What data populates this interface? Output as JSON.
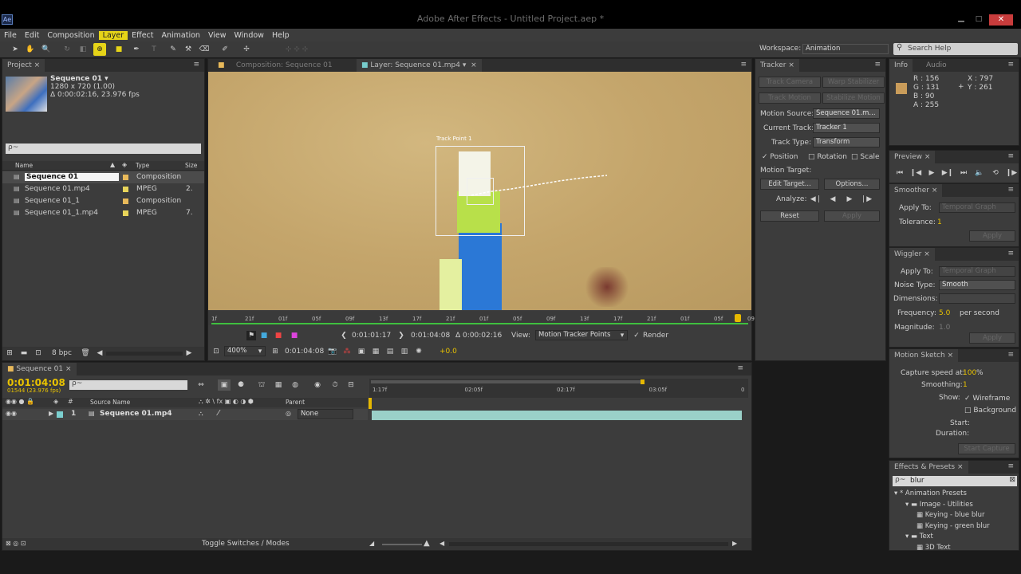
{
  "app": {
    "window_title": "Adobe After Effects - Untitled Project.aep *",
    "app_icon": "Ae"
  },
  "menu": [
    "File",
    "Edit",
    "Composition",
    "Layer",
    "Effect",
    "Animation",
    "View",
    "Window",
    "Help"
  ],
  "menu_active": "Layer",
  "workspace": {
    "label": "Workspace:",
    "value": "Animation"
  },
  "search_help": {
    "placeholder": "Search Help"
  },
  "project": {
    "tab": "Project",
    "item_name": "Sequence 01 ▾",
    "item_info1": "1280 x 720 (1.00)",
    "item_info2": "Δ 0:00:02:16, 23.976 fps",
    "search_glyph": "ρ~",
    "columns": {
      "name": "Name",
      "type": "Type",
      "size": "Size"
    },
    "rows": [
      {
        "name": "Sequence 01",
        "type": "Composition",
        "size": "",
        "color": "#e8b95a",
        "selected": true
      },
      {
        "name": "Sequence 01.mp4",
        "type": "MPEG",
        "size": "2.",
        "color": "#e8d45a",
        "selected": false
      },
      {
        "name": "Sequence 01_1",
        "type": "Composition",
        "size": "",
        "color": "#e8b95a",
        "selected": false
      },
      {
        "name": "Sequence 01_1.mp4",
        "type": "MPEG",
        "size": "7.",
        "color": "#e8d45a",
        "selected": false
      }
    ],
    "bpc": "8 bpc"
  },
  "viewer": {
    "tab_comp": "Composition: Sequence 01",
    "tab_layer": "Layer: Sequence 01.mp4",
    "track_point_label": "Track Point 1",
    "ruler_labels": [
      "1f",
      "21f",
      "01f",
      "05f",
      "09f",
      "13f",
      "17f",
      "21f",
      "01f",
      "05f",
      "09f",
      "13f",
      "17f",
      "21f",
      "01f",
      "05f",
      "09f"
    ],
    "ctrl": {
      "in_time": "0:01:01:17",
      "out_time": "0:01:04:08",
      "duration": "Δ 0:00:02:16",
      "view_label": "View:",
      "view_value": "Motion Tracker Points",
      "render_label": "Render",
      "zoom": "400%",
      "current_time": "0:01:04:08",
      "exposure": "+0.0"
    }
  },
  "tracker": {
    "tab": "Tracker",
    "track_camera": "Track Camera",
    "warp_stabilizer": "Warp Stabilizer",
    "track_motion": "Track Motion",
    "stabilize_motion": "Stabilize Motion",
    "motion_source_label": "Motion Source:",
    "motion_source_value": "Sequence 01.m...",
    "current_track_label": "Current Track:",
    "current_track_value": "Tracker 1",
    "track_type_label": "Track Type:",
    "track_type_value": "Transform",
    "position": "Position",
    "rotation": "Rotation",
    "scale": "Scale",
    "motion_target": "Motion Target:",
    "edit_target": "Edit Target...",
    "options": "Options...",
    "analyze": "Analyze:",
    "reset": "Reset",
    "apply": "Apply"
  },
  "info": {
    "tab_info": "Info",
    "tab_audio": "Audio",
    "r": "R : 156",
    "g": "G : 131",
    "b": "B : 90",
    "a": "A : 255",
    "x": "X : 797",
    "y": "Y : 261",
    "swatch": "#c99c5a"
  },
  "preview": {
    "tab": "Preview"
  },
  "smoother": {
    "tab": "Smoother",
    "apply_to_label": "Apply To:",
    "apply_to_value": "Temporal Graph",
    "tolerance_label": "Tolerance:",
    "tolerance_value": "1",
    "apply": "Apply"
  },
  "wiggler": {
    "tab": "Wiggler",
    "apply_to_label": "Apply To:",
    "apply_to_value": "Temporal Graph",
    "noise_type_label": "Noise Type:",
    "noise_type_value": "Smooth",
    "dimensions_label": "Dimensions:",
    "frequency_label": "Frequency:",
    "frequency_value": "5.0",
    "frequency_unit": "per second",
    "magnitude_label": "Magnitude:",
    "magnitude_value": "1.0",
    "apply": "Apply"
  },
  "motion_sketch": {
    "tab": "Motion Sketch",
    "capture_label": "Capture speed at:",
    "capture_value": "100",
    "capture_unit": "%",
    "smoothing_label": "Smoothing:",
    "smoothing_value": "1",
    "show_label": "Show:",
    "wireframe": "Wireframe",
    "background": "Background",
    "start_label": "Start:",
    "duration_label": "Duration:",
    "start_capture": "Start Capture"
  },
  "effects": {
    "tab": "Effects & Presets",
    "search_value": "blur",
    "tree": [
      {
        "label": "* Animation Presets",
        "level": 0
      },
      {
        "label": "Image - Utilities",
        "level": 1
      },
      {
        "label": "Keying - blue blur",
        "level": 2
      },
      {
        "label": "Keying - green blur",
        "level": 2
      },
      {
        "label": "Text",
        "level": 1
      },
      {
        "label": "3D Text",
        "level": 2
      }
    ]
  },
  "timeline": {
    "tab": "Sequence 01",
    "timecode": "0:01:04:08",
    "frames": "01544 (23.976 fps)",
    "col_source": "Source Name",
    "col_parent": "Parent",
    "layer_num": "1",
    "layer_name": "Sequence 01.mp4",
    "parent_value": "None",
    "ruler": [
      "1:17f",
      "02:05f",
      "02:17f",
      "03:05f",
      "0"
    ],
    "toggle": "Toggle Switches / Modes"
  }
}
